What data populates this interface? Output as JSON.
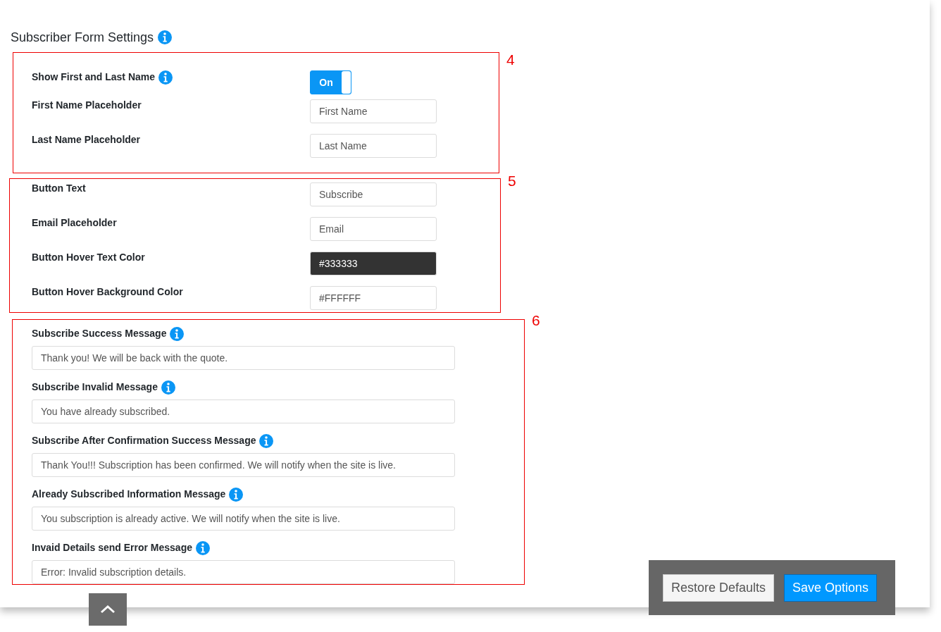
{
  "heading": "Subscriber Form Settings",
  "sections": [
    {
      "number": "4",
      "rows": [
        {
          "kind": "toggle",
          "label": "Show First and Last Name",
          "info": true,
          "on": true,
          "value": "On"
        },
        {
          "kind": "text",
          "label": "First Name Placeholder",
          "info": false,
          "value": "First Name"
        },
        {
          "kind": "text",
          "label": "Last Name Placeholder",
          "info": false,
          "value": "Last Name"
        }
      ]
    },
    {
      "number": "5",
      "rows": [
        {
          "kind": "text",
          "label": "Button Text",
          "info": false,
          "value": "Subscribe"
        },
        {
          "kind": "text",
          "label": "Email Placeholder",
          "info": false,
          "value": "Email"
        },
        {
          "kind": "color",
          "label": "Button Hover Text Color",
          "info": false,
          "value": "#333333",
          "color": "#333333"
        },
        {
          "kind": "color",
          "label": "Button Hover Background Color",
          "info": false,
          "value": "#FFFFFF",
          "color": "#ffffff"
        }
      ]
    },
    {
      "number": "6",
      "rows": [
        {
          "kind": "message",
          "label": "Subscribe Success Message",
          "info": true,
          "value": "Thank you! We will be back with the quote."
        },
        {
          "kind": "message",
          "label": "Subscribe Invalid Message",
          "info": true,
          "value": "You have already subscribed."
        },
        {
          "kind": "message",
          "label": "Subscribe After Confirmation Success Message",
          "info": true,
          "value": "Thank You!!! Subscription has been confirmed. We will notify when the site is live."
        },
        {
          "kind": "message",
          "label": "Already Subscribed Information Message",
          "info": true,
          "value": "You subscription is already active. We will notify when the site is live."
        },
        {
          "kind": "message",
          "label": "Invaid Details send Error Message",
          "info": true,
          "value": "Error: Invalid subscription details."
        }
      ]
    }
  ],
  "buttons": [
    "Restore Defaults",
    "Save Options"
  ]
}
